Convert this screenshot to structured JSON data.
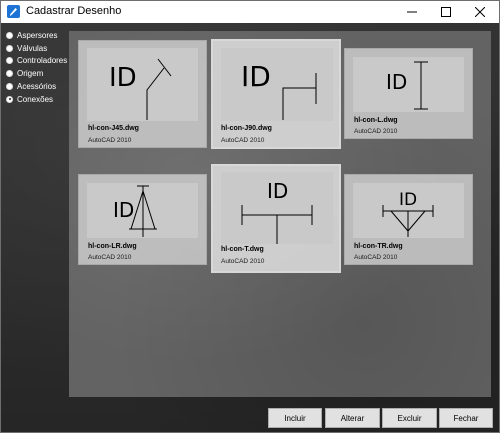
{
  "window": {
    "title": "Cadastrar Desenho",
    "icon": "app-icon"
  },
  "sidebar": {
    "items": [
      {
        "label": "Aspersores",
        "checked": false
      },
      {
        "label": "Válvulas",
        "checked": false
      },
      {
        "label": "Controladores",
        "checked": false
      },
      {
        "label": "Origem",
        "checked": false
      },
      {
        "label": "Acessórios",
        "checked": false
      },
      {
        "label": "Conexões",
        "checked": true
      }
    ]
  },
  "cards": [
    {
      "name": "hl-con-J45.dwg",
      "type": "AutoCAD 2010",
      "thumb_text": "ID",
      "selected": false
    },
    {
      "name": "hl-con-J90.dwg",
      "type": "AutoCAD 2010",
      "thumb_text": "ID",
      "selected": true
    },
    {
      "name": "hl-con-L.dwg",
      "type": "AutoCAD 2010",
      "thumb_text": "ID",
      "selected": false
    },
    {
      "name": "hl-con-LR.dwg",
      "type": "AutoCAD 2010",
      "thumb_text": "ID",
      "selected": false
    },
    {
      "name": "hl-con-T.dwg",
      "type": "AutoCAD 2010",
      "thumb_text": "ID",
      "selected": true
    },
    {
      "name": "hl-con-TR.dwg",
      "type": "AutoCAD 2010",
      "thumb_text": "ID",
      "selected": false
    }
  ],
  "buttons": {
    "incluir": "Incluir",
    "alterar": "Alterar",
    "excluir": "Excluir",
    "fechar": "Fechar"
  },
  "colors": {
    "titlebar_icon": "#1e73d6",
    "content_bg": "#636363",
    "card_bg": "#c8c8c8"
  }
}
